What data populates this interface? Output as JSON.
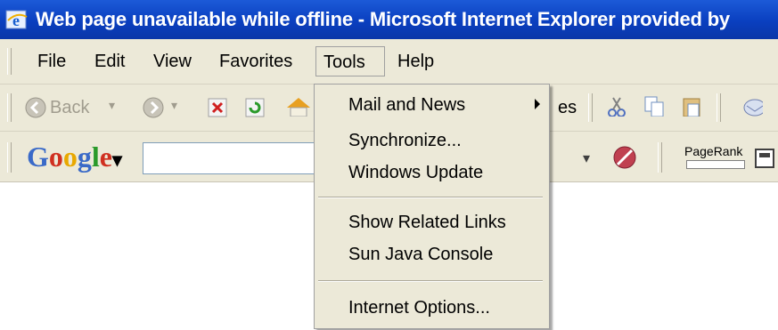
{
  "window": {
    "title": "Web page unavailable while offline - Microsoft Internet Explorer provided by"
  },
  "menubar": {
    "items": [
      "File",
      "Edit",
      "View",
      "Favorites",
      "Tools",
      "Help"
    ],
    "open_menu": "Tools"
  },
  "toolbar": {
    "back_label": "Back",
    "partial_label": "es"
  },
  "google_toolbar": {
    "logo": "Google",
    "logo_dropdown": "▾",
    "search_value": "",
    "pagerank_label": "PageRank"
  },
  "tools_menu": {
    "items": [
      {
        "label": "Mail and News",
        "submenu": true
      },
      {
        "label": "Synchronize..."
      },
      {
        "label": "Windows Update"
      },
      {
        "label": "Show Related Links"
      },
      {
        "label": "Sun Java Console"
      },
      {
        "label": "Internet Options..."
      }
    ]
  },
  "colors": {
    "titlebar": "#0a3fbf",
    "chrome": "#ece9d8"
  }
}
